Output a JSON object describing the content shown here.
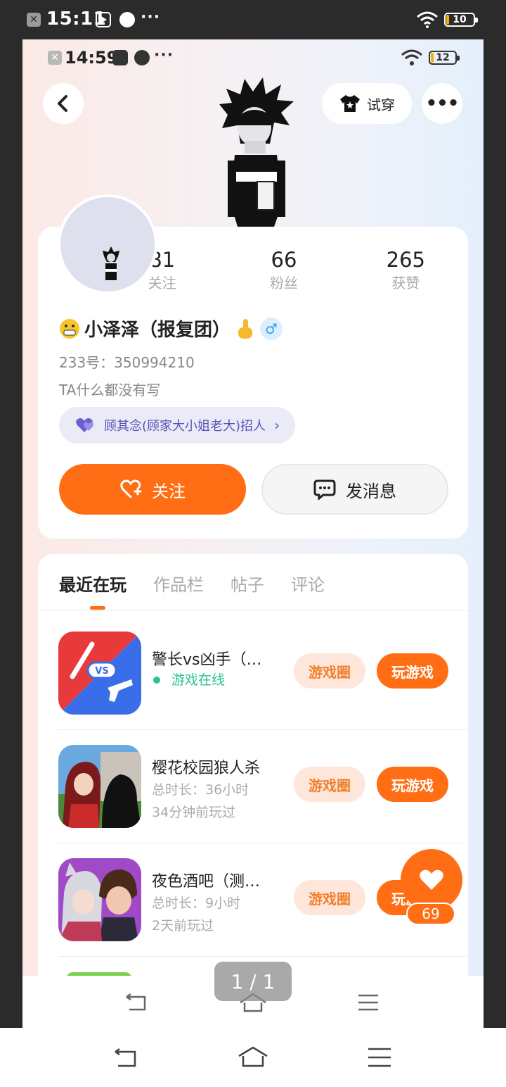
{
  "outer_status": {
    "time": "15:11",
    "battery": "10"
  },
  "inner_status": {
    "time": "14:59",
    "battery": "12"
  },
  "header": {
    "try_on_label": "试穿"
  },
  "profile": {
    "stats": [
      {
        "value": "81",
        "label": "关注"
      },
      {
        "value": "66",
        "label": "粉丝"
      },
      {
        "value": "265",
        "label": "获赞"
      }
    ],
    "name": "小泽泽（报复团）",
    "id_text": "233号：350994210",
    "bio": "TA什么都没有写",
    "team_text": "顾其念(顾家大小姐老大)招人",
    "follow_label": "关注",
    "message_label": "发消息"
  },
  "tabs": [
    {
      "label": "最近在玩"
    },
    {
      "label": "作品栏"
    },
    {
      "label": "帖子"
    },
    {
      "label": "评论"
    }
  ],
  "games": [
    {
      "title": "警长vs凶手（…",
      "status": "游戏在线",
      "circle_label": "游戏圈",
      "play_label": "玩游戏"
    },
    {
      "title": "樱花校园狼人杀",
      "duration": "总时长：36小时",
      "last_played": "34分钟前玩过",
      "circle_label": "游戏圈",
      "play_label": "玩游戏"
    },
    {
      "title": "夜色酒吧（测…",
      "duration": "总时长：9小时",
      "last_played": "2天前玩过",
      "circle_label": "游戏圈",
      "play_label": "玩游戏"
    }
  ],
  "like_fab": {
    "count": "69"
  },
  "page_indicator": "1 / 1",
  "colors": {
    "accent": "#ff6e14",
    "online": "#2cc38b",
    "team": "#5a4fb8"
  }
}
